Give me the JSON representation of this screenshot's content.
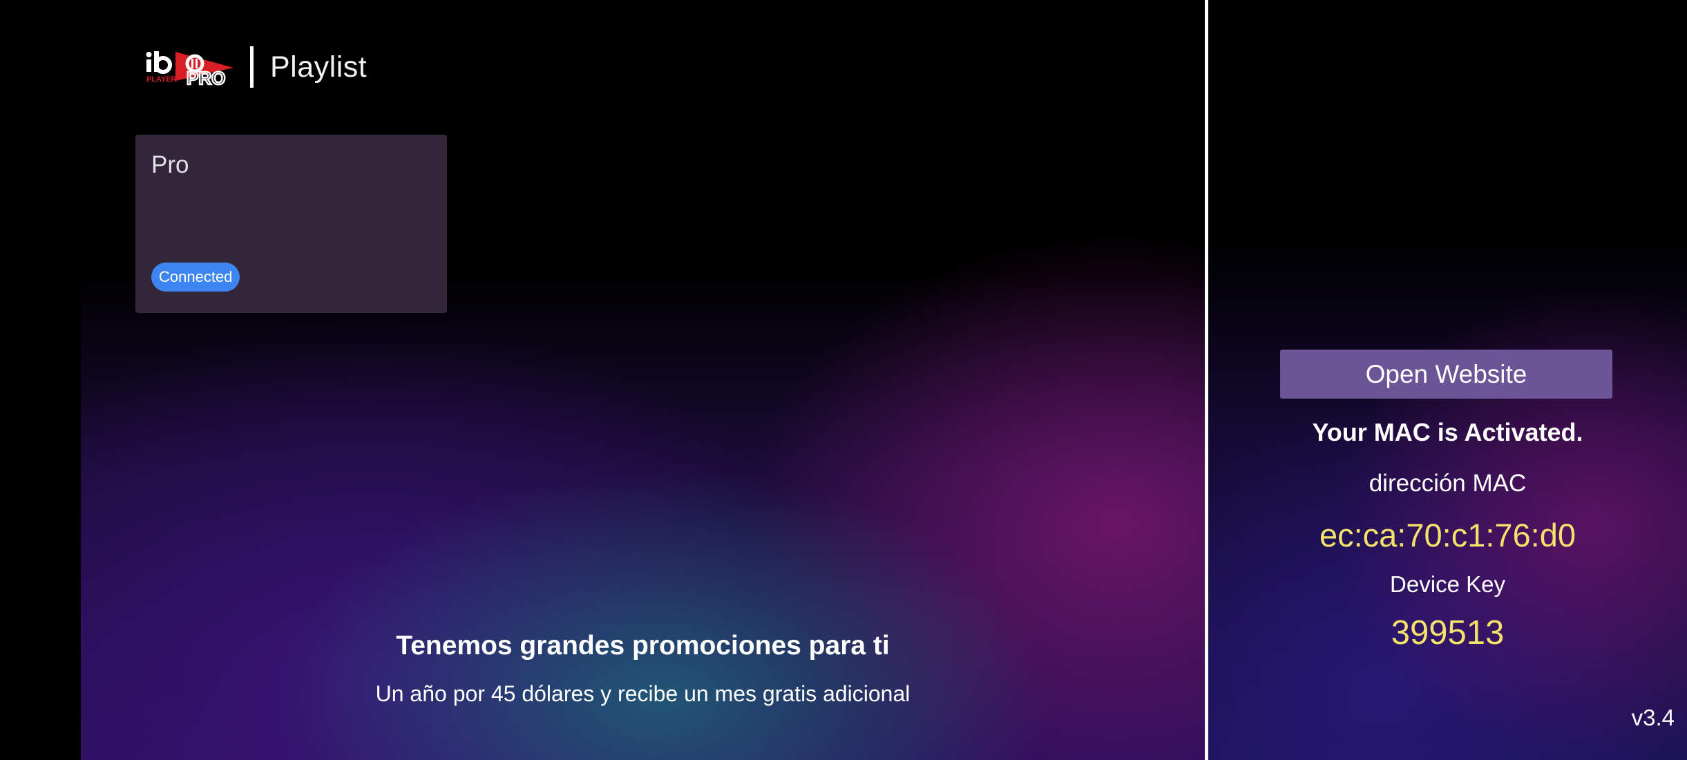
{
  "header": {
    "logo_text": "ibo PLAYER PRO",
    "title": "Playlist"
  },
  "playlists": [
    {
      "name": "Pro",
      "status": "Connected"
    }
  ],
  "promo": {
    "title": "Tenemos grandes promociones para ti",
    "text": "Un año por 45 dólares y recibe un mes gratis adicional"
  },
  "device": {
    "open_website_label": "Open Website",
    "activation_status": "Your MAC is Activated.",
    "mac_label": "dirección MAC",
    "mac_value": "ec:ca:70:c1:76:d0",
    "key_label": "Device Key",
    "key_value": "399513"
  },
  "version": "v3.4",
  "colors": {
    "badge": "#3d85f0",
    "button": "#6b5596",
    "highlight": "#f5e26a",
    "card": "#342639",
    "logo_red": "#d81f26"
  }
}
